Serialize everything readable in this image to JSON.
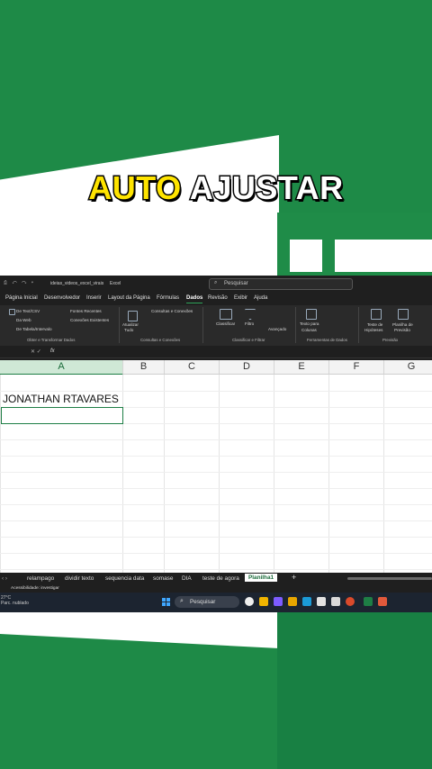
{
  "overlay": {
    "title_word1": "AUTO",
    "title_word2": "AJUSTAR"
  },
  "titlebar": {
    "filename": "ideias_videos_excel_virais",
    "app": "Excel",
    "search_placeholder": "Pesquisar"
  },
  "tabs": [
    "Página Inicial",
    "Desenvolvedor",
    "Inserir",
    "Layout da Página",
    "Fórmulas",
    "Dados",
    "Revisão",
    "Exibir",
    "Ajuda"
  ],
  "active_tab": "Dados",
  "ribbon": {
    "g1": {
      "a": "De Text/CSV",
      "b": "Da Web",
      "c": "De Tabela/Intervalo",
      "d": "Fontes Recentes",
      "e": "Conexões Existentes",
      "label": "Obter e Transformar Dados"
    },
    "g2": {
      "btn": "Atualizar",
      "btn2": "Tudo",
      "a": "Consultas e Conexões",
      "label": "Consultas e Conexões"
    },
    "g3": {
      "a": "Classificar",
      "b": "Filtro",
      "c": "Avançado",
      "label": "Classificar e Filtrar"
    },
    "g4": {
      "a": "Texto para",
      "b": "Colunas",
      "label": "Ferramentas de Dados"
    },
    "g5": {
      "a": "Teste de",
      "b": "Hipóteses",
      "c": "Planilha de",
      "d": "Previsão",
      "label": "Previsão"
    }
  },
  "formula_bar": {
    "fx": "fx"
  },
  "columns": [
    "A",
    "B",
    "C",
    "D",
    "E",
    "F",
    "G"
  ],
  "cells": {
    "A1": "JONATHAN RTAVARES"
  },
  "sheet_tabs": [
    "relampago",
    "dividir texto",
    "sequencia data",
    "somase",
    "DIA",
    "teste de agora",
    "Planilha1"
  ],
  "active_sheet": "Planilha1",
  "status": {
    "accessibility": "Acessibilidade: investigar"
  },
  "taskbar": {
    "temp": "27°C",
    "weather": "Parc. nublado",
    "search": "Pesquisar"
  },
  "colors": {
    "accent": "#1e7e45",
    "brand_green": "#1e8a47",
    "title_yellow": "#ffe400"
  }
}
